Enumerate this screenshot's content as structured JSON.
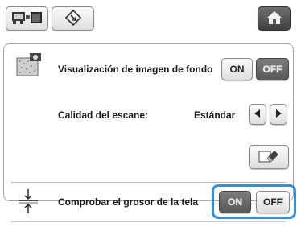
{
  "toolbar": {
    "icons": [
      "embroidery-machine-icon",
      "diamond-arrow-icon",
      "home-icon"
    ]
  },
  "settings": {
    "background_image": {
      "label": "Visualización de imagen de fondo",
      "on_label": "ON",
      "off_label": "OFF",
      "selected": "OFF",
      "icon": "background-image-icon"
    },
    "scan_quality": {
      "label": "Calidad del escane:",
      "value": "Estándar",
      "prev_icon": "triangle-left-icon",
      "next_icon": "triangle-right-icon"
    },
    "eraser": {
      "icon": "eraser-icon"
    },
    "fabric_thickness": {
      "label": "Comprobar el grosor de la tela",
      "on_label": "ON",
      "off_label": "OFF",
      "selected": "ON",
      "icon": "fabric-thickness-icon"
    }
  },
  "colors": {
    "highlight": "#2f8fe8",
    "active_button": "#5f5f5f"
  }
}
